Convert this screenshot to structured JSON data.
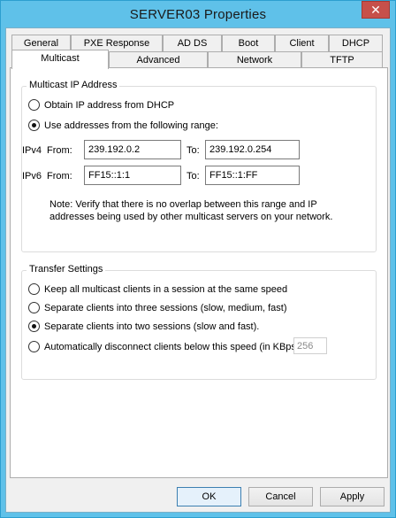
{
  "window": {
    "title": "SERVER03 Properties",
    "close_glyph": "✕"
  },
  "tabs_row1": [
    "General",
    "PXE Response",
    "AD DS",
    "Boot",
    "Client",
    "DHCP"
  ],
  "tabs_row2": [
    "Multicast",
    "Advanced",
    "Network",
    "TFTP"
  ],
  "multicast": {
    "legend": "Multicast IP Address",
    "opt_dhcp": "Obtain IP address from DHCP",
    "opt_range": "Use addresses from the following range:",
    "ipv4_label": "IPv4",
    "ipv6_label": "IPv6",
    "from_label": "From:",
    "to_label": "To:",
    "ipv4_from": "239.192.0.2",
    "ipv4_to": "239.192.0.254",
    "ipv6_from": "FF15::1:1",
    "ipv6_to": "FF15::1:FF",
    "note_line1": "Note: Verify that there is no overlap between this range and IP",
    "note_line2": "addresses being used by other multicast servers on your network."
  },
  "transfer": {
    "legend": "Transfer Settings",
    "opt_same": "Keep all multicast clients in a session at the same speed",
    "opt_three": "Separate clients into three sessions (slow, medium, fast)",
    "opt_two": "Separate clients into two sessions (slow and fast).",
    "opt_disconnect": "Automatically disconnect clients below this speed (in KBps):",
    "speed_value": "256"
  },
  "buttons": {
    "ok": "OK",
    "cancel": "Cancel",
    "apply": "Apply"
  },
  "colors": {
    "titlebar": "#5fc1e9",
    "close": "#c7504a"
  }
}
